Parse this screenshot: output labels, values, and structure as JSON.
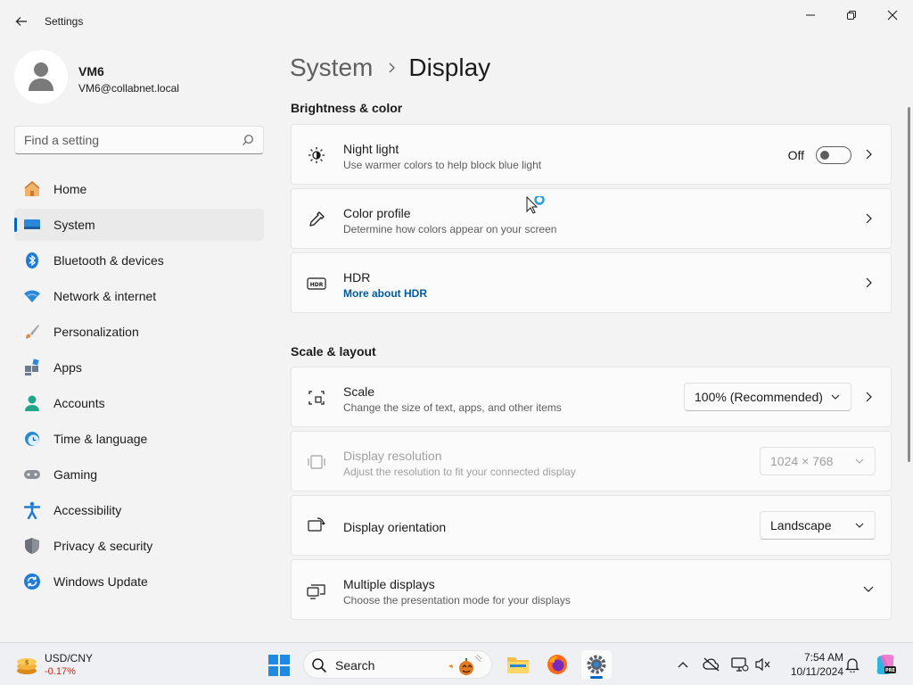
{
  "window": {
    "title": "Settings",
    "controls": [
      "minimize",
      "maximize",
      "close"
    ]
  },
  "profile": {
    "name": "VM6",
    "email": "VM6@collabnet.local"
  },
  "search": {
    "placeholder": "Find a setting"
  },
  "sidebar": {
    "items": [
      {
        "label": "Home",
        "icon": "home-icon"
      },
      {
        "label": "System",
        "icon": "system-icon",
        "active": true
      },
      {
        "label": "Bluetooth & devices",
        "icon": "bluetooth-icon"
      },
      {
        "label": "Network & internet",
        "icon": "network-icon"
      },
      {
        "label": "Personalization",
        "icon": "brush-icon"
      },
      {
        "label": "Apps",
        "icon": "apps-icon"
      },
      {
        "label": "Accounts",
        "icon": "accounts-icon"
      },
      {
        "label": "Time & language",
        "icon": "clock-globe-icon"
      },
      {
        "label": "Gaming",
        "icon": "gamepad-icon"
      },
      {
        "label": "Accessibility",
        "icon": "accessibility-icon"
      },
      {
        "label": "Privacy & security",
        "icon": "shield-icon"
      },
      {
        "label": "Windows Update",
        "icon": "update-icon"
      }
    ]
  },
  "breadcrumb": {
    "parent": "System",
    "current": "Display"
  },
  "sections": {
    "brightness": {
      "title": "Brightness & color",
      "night_light": {
        "title": "Night light",
        "subtitle": "Use warmer colors to help block blue light",
        "state": "Off"
      },
      "color_profile": {
        "title": "Color profile",
        "subtitle": "Determine how colors appear on your screen"
      },
      "hdr": {
        "title": "HDR",
        "link": "More about HDR"
      }
    },
    "scale_layout": {
      "title": "Scale & layout",
      "scale": {
        "title": "Scale",
        "subtitle": "Change the size of text, apps, and other items",
        "value": "100% (Recommended)"
      },
      "resolution": {
        "title": "Display resolution",
        "subtitle": "Adjust the resolution to fit your connected display",
        "value": "1024 × 768"
      },
      "orientation": {
        "title": "Display orientation",
        "value": "Landscape"
      },
      "multiple": {
        "title": "Multiple displays",
        "subtitle": "Choose the presentation mode for your displays"
      }
    }
  },
  "taskbar": {
    "widget": {
      "title": "USD/CNY",
      "value": "-0.17%"
    },
    "search_label": "Search",
    "apps": [
      "start-icon",
      "file-explorer-icon",
      "firefox-icon",
      "settings-icon"
    ],
    "clock": {
      "time": "7:54 AM",
      "date": "10/11/2024"
    }
  },
  "colors": {
    "accent": "#0067c0",
    "negative": "#c42b1c"
  }
}
